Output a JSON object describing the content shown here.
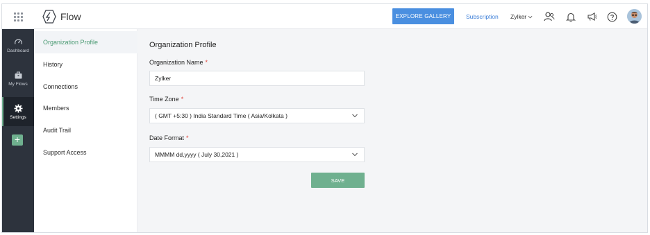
{
  "app": {
    "name": "Flow"
  },
  "header": {
    "explore_label": "EXPLORE GALLERY",
    "subscription_label": "Subscription",
    "org_name": "Zylker",
    "icons": [
      "apps-grid-icon",
      "flow-logo-icon",
      "chevron-down-icon",
      "users-icon",
      "bell-icon",
      "megaphone-icon",
      "help-icon",
      "avatar"
    ]
  },
  "rail": {
    "items": [
      {
        "label": "Dashboard",
        "icon": "dashboard-icon"
      },
      {
        "label": "My Flows",
        "icon": "briefcase-icon"
      },
      {
        "label": "Settings",
        "icon": "gear-icon",
        "active": true
      }
    ],
    "add_icon": "plus-icon"
  },
  "subnav": {
    "items": [
      {
        "label": "Organization Profile",
        "active": true
      },
      {
        "label": "History"
      },
      {
        "label": "Connections"
      },
      {
        "label": "Members"
      },
      {
        "label": "Audit Trail"
      },
      {
        "label": "Support Access"
      }
    ]
  },
  "form": {
    "title": "Organization Profile",
    "org_name_label": "Organization Name",
    "org_name_value": "Zylker",
    "timezone_label": "Time Zone",
    "timezone_value": "( GMT +5:30 ) India Standard Time ( Asia/Kolkata )",
    "date_format_label": "Date Format",
    "date_format_value": "MMMM dd,yyyy ( July 30,2021 )",
    "required_mark": "*",
    "save_label": "SAVE"
  },
  "colors": {
    "accent_green": "#6fb08f",
    "active_text_green": "#4b9a73",
    "explore_blue": "#4a8fe0",
    "rail_bg": "#2d333d",
    "required_red": "#e0463c"
  }
}
